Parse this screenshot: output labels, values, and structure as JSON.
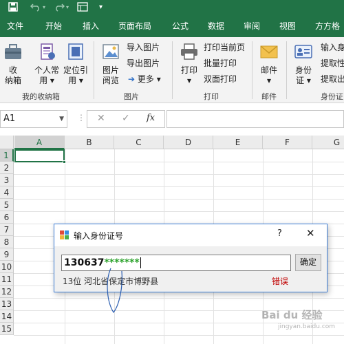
{
  "ribbon_tabs": [
    "文件",
    "开始",
    "插入",
    "页面布局",
    "公式",
    "数据",
    "审阅",
    "视图",
    "方方格"
  ],
  "ribbon": {
    "collect_label": "收\n纳箱",
    "personal_label": "个人常\n用 ▾",
    "locate_label": "定位引\n用 ▾",
    "group_mybox": "我的收纳箱",
    "image_browse_label": "图片\n阅览",
    "import_image": "导入图片",
    "export_image": "导出图片",
    "more": "更多 ▾",
    "group_image": "图片",
    "print_label": "打印\n▾",
    "print_current": "打印当前页",
    "batch_print": "批量打印",
    "duplex_print": "双面打印",
    "group_print": "打印",
    "mail_label": "邮件\n▾",
    "group_mail": "邮件",
    "idcard_label": "身份\n证 ▾",
    "input_id": "输入身",
    "extract1": "提取性",
    "extract2": "提取出",
    "group_idcard": "身份证"
  },
  "formula_bar": {
    "name_box": "A1",
    "cancel_icon": "✕",
    "confirm_icon": "✓",
    "fx_label": "fx",
    "separator": "⋮"
  },
  "grid": {
    "columns": [
      "A",
      "B",
      "C",
      "D",
      "E",
      "F",
      "G"
    ],
    "rows": [
      "1",
      "2",
      "3",
      "4",
      "5",
      "6",
      "7",
      "8",
      "9",
      "10",
      "11",
      "12",
      "13",
      "14",
      "15"
    ]
  },
  "dialog": {
    "title": "输入身份证号",
    "help": "?",
    "close": "✕",
    "input_digits": "130637",
    "input_stars": "*******",
    "ok_label": "确定",
    "info": "13位  河北省保定市博野县",
    "error": "错误"
  },
  "watermark": {
    "text": "Bai du 经验",
    "sub": "jingyan.baidu.com"
  },
  "colors": {
    "excel_green": "#217346",
    "error_red": "#c00000",
    "star_green": "#2aa12a"
  }
}
